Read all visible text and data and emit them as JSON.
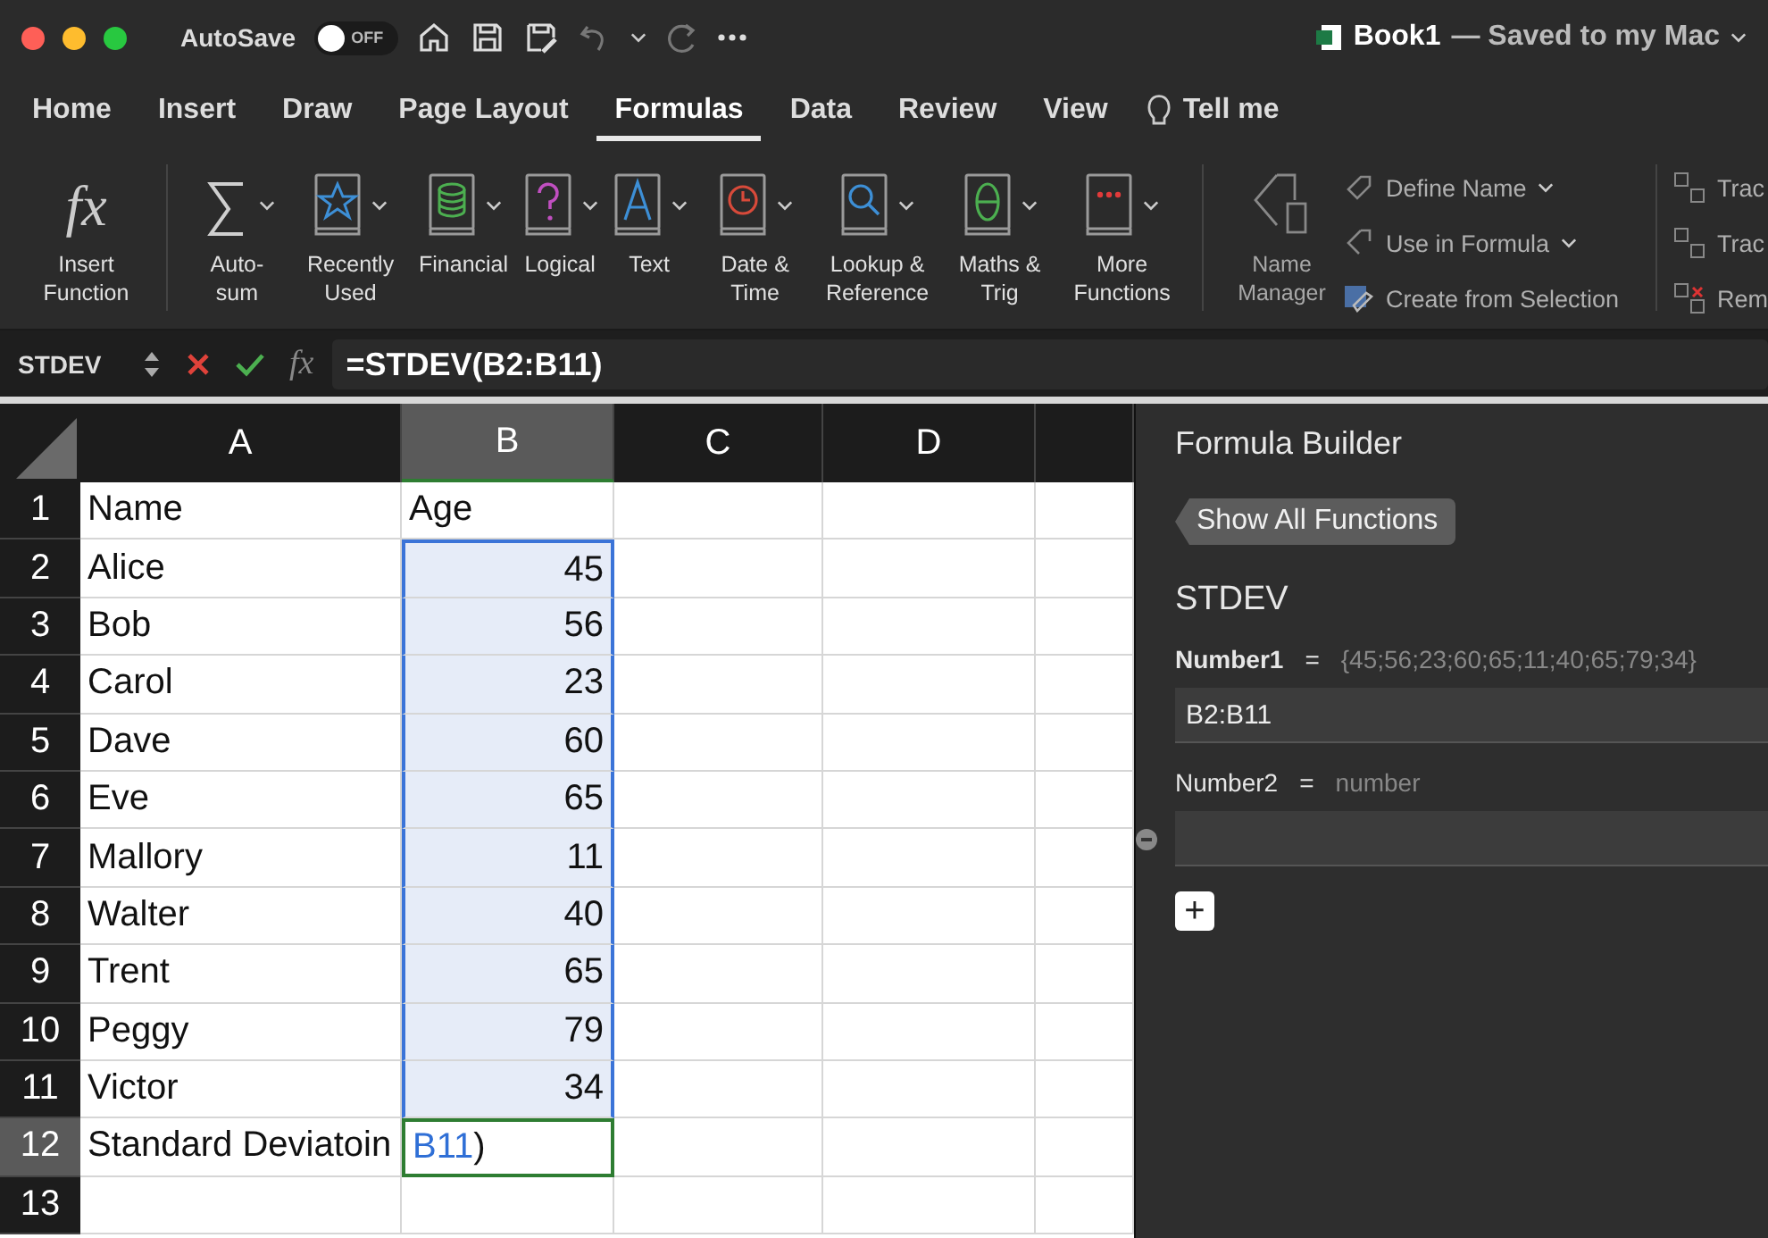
{
  "titlebar": {
    "autosave_label": "AutoSave",
    "autosave": {
      "on": false,
      "label": "OFF"
    },
    "document_name": "Book1",
    "save_status": "— Saved to my Mac"
  },
  "tabs": [
    {
      "label": "Home",
      "selected": false
    },
    {
      "label": "Insert",
      "selected": false
    },
    {
      "label": "Draw",
      "selected": false
    },
    {
      "label": "Page Layout",
      "selected": false
    },
    {
      "label": "Formulas",
      "selected": true
    },
    {
      "label": "Data",
      "selected": false
    },
    {
      "label": "Review",
      "selected": false
    },
    {
      "label": "View",
      "selected": false
    }
  ],
  "tell_me": "Tell me",
  "ribbon": {
    "functions": [
      {
        "glyph": "fx",
        "label": "Insert Function",
        "dropdown": false
      },
      {
        "label": "Auto-sum",
        "dropdown": true
      },
      {
        "label": "Recently Used",
        "dropdown": true
      },
      {
        "label": "Financial",
        "dropdown": true
      },
      {
        "label": "Logical",
        "dropdown": true
      },
      {
        "label": "Text",
        "dropdown": true
      },
      {
        "label": "Date & Time",
        "dropdown": true
      },
      {
        "label": "Lookup & Reference",
        "dropdown": true
      },
      {
        "label": "Maths & Trig",
        "dropdown": true
      },
      {
        "label": "More Functions",
        "dropdown": true
      }
    ],
    "name_manager": "Name Manager",
    "names": [
      {
        "label": "Define Name",
        "dropdown": true
      },
      {
        "label": "Use in Formula",
        "dropdown": true
      },
      {
        "label": "Create from Selection",
        "dropdown": false
      }
    ],
    "auditing": [
      "Trac",
      "Trac",
      "Rem"
    ]
  },
  "formula_bar": {
    "name_box": "STDEV",
    "fx": "fx",
    "formula": "=STDEV(B2:B11)"
  },
  "columns": [
    {
      "label": "A",
      "selected": false
    },
    {
      "label": "B",
      "selected": true
    },
    {
      "label": "C",
      "selected": false
    },
    {
      "label": "D",
      "selected": false
    }
  ],
  "rows": [
    {
      "number": "1",
      "a": "Name",
      "b": "Age",
      "kind": "text",
      "selected": false,
      "in_range": false
    },
    {
      "number": "2",
      "a": "Alice",
      "b": "45",
      "kind": "number",
      "selected": false,
      "in_range": true
    },
    {
      "number": "3",
      "a": "Bob",
      "b": "56",
      "kind": "number",
      "selected": false,
      "in_range": true
    },
    {
      "number": "4",
      "a": "Carol",
      "b": "23",
      "kind": "number",
      "selected": false,
      "in_range": true
    },
    {
      "number": "5",
      "a": "Dave",
      "b": "60",
      "kind": "number",
      "selected": false,
      "in_range": true
    },
    {
      "number": "6",
      "a": "Eve",
      "b": "65",
      "kind": "number",
      "selected": false,
      "in_range": true
    },
    {
      "number": "7",
      "a": "Mallory",
      "b": "11",
      "kind": "number",
      "selected": false,
      "in_range": true
    },
    {
      "number": "8",
      "a": "Walter",
      "b": "40",
      "kind": "number",
      "selected": false,
      "in_range": true
    },
    {
      "number": "9",
      "a": "Trent",
      "b": "65",
      "kind": "number",
      "selected": false,
      "in_range": true
    },
    {
      "number": "10",
      "a": "Peggy",
      "b": "79",
      "kind": "number",
      "selected": false,
      "in_range": true
    },
    {
      "number": "11",
      "a": "Victor",
      "b": "34",
      "kind": "number",
      "selected": false,
      "in_range": true
    },
    {
      "number": "12",
      "a": "Standard Deviatoin",
      "b_ref": "B11",
      "b": ")",
      "kind": "text",
      "selected": true,
      "in_range": false
    },
    {
      "number": "13",
      "selected": false,
      "in_range": false
    }
  ],
  "formula_builder": {
    "title": "Formula Builder",
    "back_button": "Show All Functions",
    "function": "STDEV",
    "arguments": [
      {
        "name": "Number1",
        "equals": "=",
        "preview": "{45;56;23;60;65;11;40;65;79;34}",
        "value": "B2:B11",
        "bold": true
      },
      {
        "name": "Number2",
        "equals": "=",
        "preview": "number",
        "bold": false
      }
    ],
    "add_button": "+"
  }
}
